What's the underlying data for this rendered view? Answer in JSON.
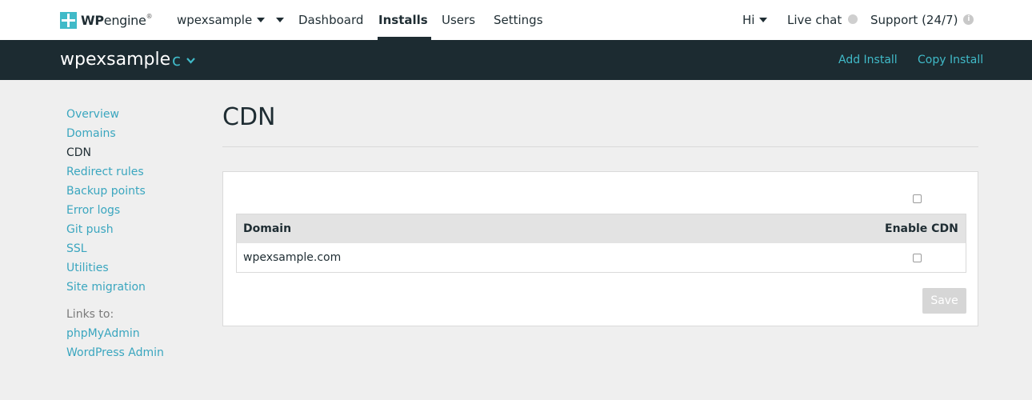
{
  "brand": {
    "mark": "WP",
    "word": "engine",
    "tm": "®"
  },
  "nav": {
    "account": "wpexsample",
    "dashboard": "Dashboard",
    "installs": "Installs",
    "users": "Users",
    "settings": "Settings",
    "greeting": "Hi",
    "live_chat": "Live chat",
    "support": "Support (24/7)",
    "info_glyph": "i"
  },
  "subheader": {
    "install_name": "wpexsample",
    "environment": "c",
    "add_install": "Add Install",
    "copy_install": "Copy Install"
  },
  "sidebar": {
    "items": [
      "Overview",
      "Domains",
      "CDN",
      "Redirect rules",
      "Backup points",
      "Error logs",
      "Git push",
      "SSL",
      "Utilities",
      "Site migration"
    ],
    "links_label": "Links to:",
    "links": [
      "phpMyAdmin",
      "WordPress Admin"
    ]
  },
  "page": {
    "title": "CDN",
    "table": {
      "col_domain": "Domain",
      "col_enable": "Enable CDN",
      "rows": [
        {
          "domain": "wpexsample.com",
          "enabled": false
        }
      ]
    },
    "select_all_checked": false,
    "save_label": "Save"
  },
  "colors": {
    "accent": "#40bac8",
    "link": "#3aa6bf",
    "header_dark": "#1c2b31",
    "text_dark": "#1f2d33",
    "disabled_button": "#d6d6d6"
  }
}
